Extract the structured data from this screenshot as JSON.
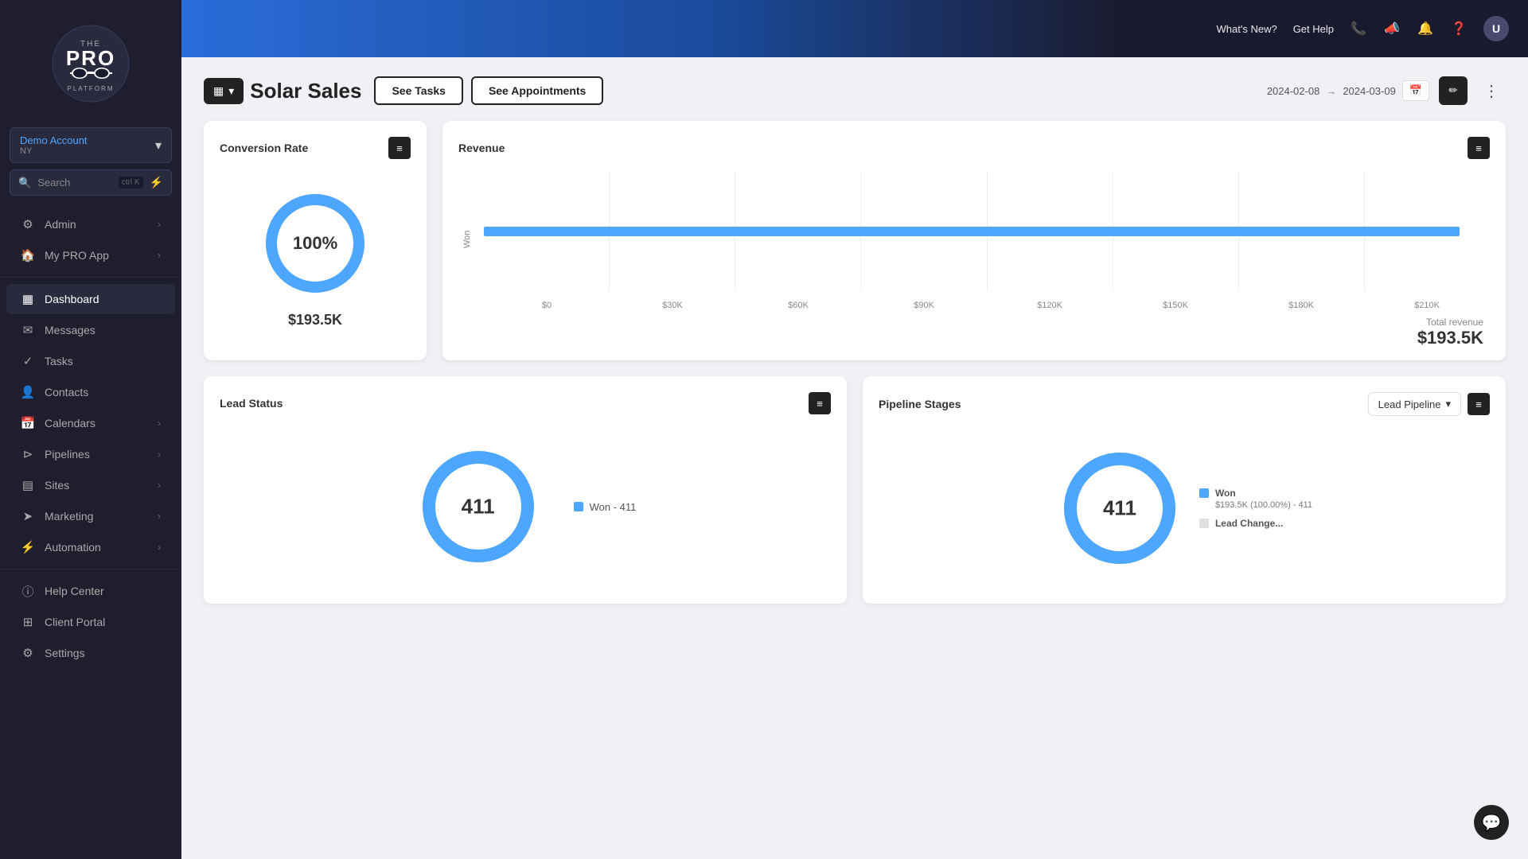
{
  "sidebar": {
    "logo": {
      "line1": "THE",
      "line2": "PRO",
      "line3": "PLATFORM"
    },
    "account": {
      "name": "Demo Account",
      "sub": "NY",
      "arrow": "▾"
    },
    "search": {
      "placeholder": "Search",
      "kbd": "ctrl K"
    },
    "nav": [
      {
        "id": "admin",
        "icon": "⚙",
        "label": "Admin",
        "arrow": "›",
        "active": false
      },
      {
        "id": "my-pro-app",
        "icon": "🏠",
        "label": "My PRO App",
        "arrow": "›",
        "active": false
      },
      {
        "id": "dashboard",
        "icon": "▦",
        "label": "Dashboard",
        "arrow": "",
        "active": true
      },
      {
        "id": "messages",
        "icon": "✉",
        "label": "Messages",
        "arrow": "",
        "active": false
      },
      {
        "id": "tasks",
        "icon": "✓",
        "label": "Tasks",
        "arrow": "",
        "active": false
      },
      {
        "id": "contacts",
        "icon": "👤",
        "label": "Contacts",
        "arrow": "",
        "active": false
      },
      {
        "id": "calendars",
        "icon": "📅",
        "label": "Calendars",
        "arrow": "›",
        "active": false
      },
      {
        "id": "pipelines",
        "icon": "⊳",
        "label": "Pipelines",
        "arrow": "›",
        "active": false
      },
      {
        "id": "sites",
        "icon": "▤",
        "label": "Sites",
        "arrow": "›",
        "active": false
      },
      {
        "id": "marketing",
        "icon": "➤",
        "label": "Marketing",
        "arrow": "›",
        "active": false
      },
      {
        "id": "automation",
        "icon": "⚡",
        "label": "Automation",
        "arrow": "›",
        "active": false
      },
      {
        "id": "help-center",
        "icon": "ⓘ",
        "label": "Help Center",
        "arrow": "",
        "active": false
      },
      {
        "id": "client-portal",
        "icon": "⊞",
        "label": "Client Portal",
        "arrow": "",
        "active": false
      },
      {
        "id": "settings",
        "icon": "⚙",
        "label": "Settings",
        "arrow": "",
        "active": false
      }
    ]
  },
  "topbar": {
    "whats_new": "What's New?",
    "get_help": "Get Help"
  },
  "dashboard": {
    "board_btn_icon": "▦",
    "title": "Solar Sales",
    "see_tasks": "See Tasks",
    "see_appointments": "See Appointments",
    "date_from": "2024-02-08",
    "date_arrow": "→",
    "date_to": "2024-03-09",
    "more_dots": "⋮"
  },
  "conversion_rate": {
    "title": "Conversion Rate",
    "percentage": "100%",
    "value": "$193.5K"
  },
  "revenue": {
    "title": "Revenue",
    "total_label": "Total revenue",
    "total_value": "$193.5K",
    "x_labels": [
      "$0",
      "$30K",
      "$60K",
      "$90K",
      "$120K",
      "$150K",
      "$180K",
      "$210K"
    ],
    "y_label": "Won",
    "bar_percent": 97
  },
  "lead_status": {
    "title": "Lead Status",
    "count": "411",
    "legend": [
      {
        "color": "#4da6ff",
        "label": "Won - 411"
      }
    ]
  },
  "pipeline_stages": {
    "title": "Pipeline Stages",
    "dropdown": "Lead Pipeline",
    "count": "411",
    "legend": [
      {
        "color": "#4da6ff",
        "label": "Won",
        "detail": "$193.5K (100.00%) - 411"
      },
      {
        "color": "#e0e0e0",
        "label": "Lead Change...",
        "detail": ""
      }
    ]
  }
}
